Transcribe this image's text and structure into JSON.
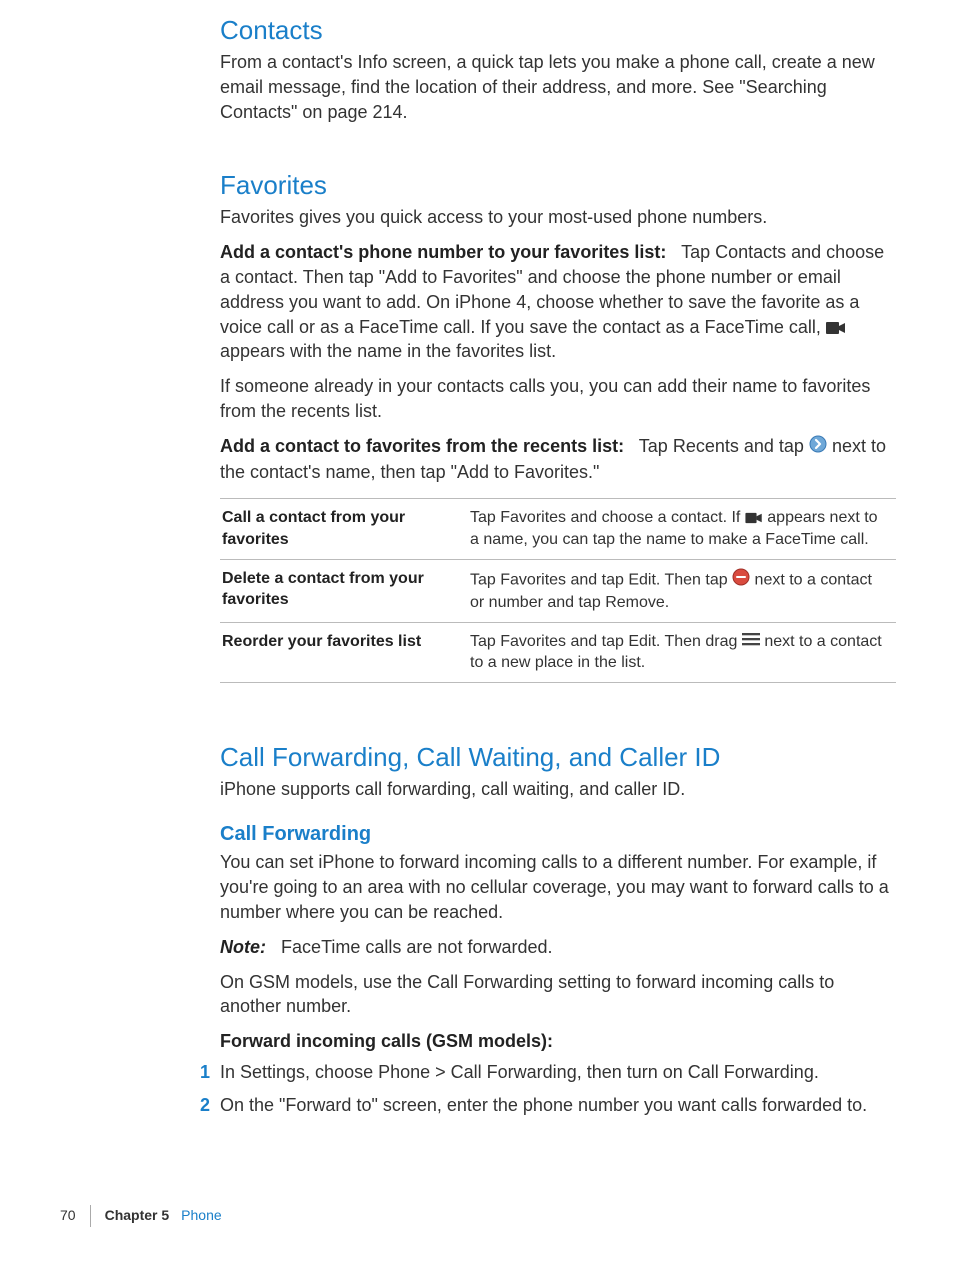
{
  "section_contacts": {
    "heading": "Contacts",
    "body": "From a contact's Info screen, a quick tap lets you make a phone call, create a new email message, find the location of their address, and more. See \"Searching Contacts\" on page 214."
  },
  "section_favorites": {
    "heading": "Favorites",
    "intro": "Favorites gives you quick access to your most-used phone numbers.",
    "add_label": "Add a contact's phone number to your favorites list:",
    "add_body_a": "Tap Contacts and choose a contact. Then tap \"Add to Favorites\" and choose the phone number or email address you want to add. On iPhone 4, choose whether to save the favorite as a voice call or as a FaceTime call. If you save the contact as a FaceTime call, ",
    "add_body_b": " appears with the name in the favorites list.",
    "recents_intro": "If someone already in your contacts calls you, you can add their name to favorites from the recents list.",
    "recents_label": "Add a contact to favorites from the recents list:",
    "recents_body_a": "Tap Recents and tap ",
    "recents_body_b": " next to the contact's name, then tap \"Add to Favorites.\"",
    "table": [
      {
        "left": "Call a contact from your favorites",
        "r1": "Tap Favorites and choose a contact. If ",
        "r2": " appears next to a name, you can tap the name to make a FaceTime call.",
        "icon": "cam"
      },
      {
        "left": "Delete a contact from your favorites",
        "r1": "Tap Favorites and tap Edit. Then tap ",
        "r2": " next to a contact or number and tap Remove.",
        "icon": "minus"
      },
      {
        "left": "Reorder your favorites list",
        "r1": "Tap Favorites and tap Edit. Then drag ",
        "r2": " next to a contact to a new place in the list.",
        "icon": "drag"
      }
    ]
  },
  "section_callfwd": {
    "heading": "Call Forwarding, Call Waiting, and Caller ID",
    "intro": "iPhone supports call forwarding, call waiting, and caller ID.",
    "sub": "Call Forwarding",
    "body1": "You can set iPhone to forward incoming calls to a different number. For example, if you're going to an area with no cellular coverage, you may want to forward calls to a number where you can be reached.",
    "note_label": "Note:",
    "note_body": "FaceTime calls are not forwarded.",
    "body2": "On GSM models, use the Call Forwarding setting to forward incoming calls to another number.",
    "steps_heading": "Forward incoming calls (GSM models):",
    "steps": [
      "In Settings, choose Phone > Call Forwarding, then turn on Call Forwarding.",
      "On the \"Forward to\" screen, enter the phone number you want calls forwarded to."
    ]
  },
  "footer": {
    "page": "70",
    "chapter_label": "Chapter 5",
    "chapter_name": "Phone"
  }
}
